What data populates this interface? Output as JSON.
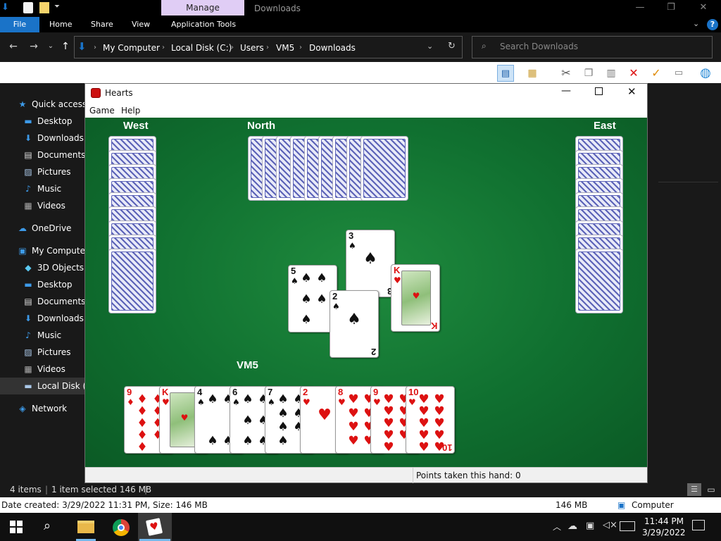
{
  "explorer": {
    "manage_tab": "Manage",
    "window_title": "Downloads",
    "ribbon_tabs": [
      "File",
      "Home",
      "Share",
      "View",
      "Application Tools"
    ],
    "breadcrumb": [
      "My Computer",
      "Local Disk (C:)",
      "Users",
      "VM5",
      "Downloads"
    ],
    "search_placeholder": "Search Downloads",
    "nav": [
      {
        "label": "Quick access",
        "icon": "star-icon",
        "indent": false
      },
      {
        "label": "Desktop",
        "icon": "desktop-icon",
        "indent": true
      },
      {
        "label": "Downloads",
        "icon": "download-icon",
        "indent": true
      },
      {
        "label": "Documents",
        "icon": "document-icon",
        "indent": true
      },
      {
        "label": "Pictures",
        "icon": "pictures-icon",
        "indent": true
      },
      {
        "label": "Music",
        "icon": "music-icon",
        "indent": true
      },
      {
        "label": "Videos",
        "icon": "videos-icon",
        "indent": true
      },
      {
        "label": "OneDrive",
        "icon": "cloud-icon",
        "indent": false
      },
      {
        "label": "My Computer",
        "icon": "computer-icon",
        "indent": false
      },
      {
        "label": "3D Objects",
        "icon": "cube-icon",
        "indent": true
      },
      {
        "label": "Desktop",
        "icon": "desktop-icon",
        "indent": true
      },
      {
        "label": "Documents",
        "icon": "document-icon",
        "indent": true
      },
      {
        "label": "Downloads",
        "icon": "download-icon",
        "indent": true
      },
      {
        "label": "Music",
        "icon": "music-icon",
        "indent": true
      },
      {
        "label": "Pictures",
        "icon": "pictures-icon",
        "indent": true
      },
      {
        "label": "Videos",
        "icon": "videos-icon",
        "indent": true
      },
      {
        "label": "Local Disk (C",
        "icon": "disk-icon",
        "indent": true
      },
      {
        "label": "Network",
        "icon": "network-icon",
        "indent": false
      }
    ],
    "status_items": "4 items",
    "status_selected": "1 item selected  146 MB",
    "details_text": "Date created: 3/29/2022 11:31 PM, Size: 146 MB",
    "details_size": "146 MB",
    "details_location": "Computer"
  },
  "hearts": {
    "title": "Hearts",
    "menu": [
      "Game",
      "Help"
    ],
    "players": {
      "west": "West",
      "north": "North",
      "east": "East",
      "south": "VM5"
    },
    "status": "Points taken this hand: 0",
    "trick": [
      {
        "rank": "3",
        "suit": "♠",
        "color": "black"
      },
      {
        "rank": "5",
        "suit": "♠",
        "color": "black"
      },
      {
        "rank": "K",
        "suit": "♥",
        "color": "red",
        "face": true
      },
      {
        "rank": "2",
        "suit": "♠",
        "color": "black"
      }
    ],
    "hand": [
      {
        "rank": "9",
        "suit": "♦",
        "color": "red"
      },
      {
        "rank": "K",
        "suit": "♥",
        "color": "red",
        "face": true
      },
      {
        "rank": "4",
        "suit": "♠",
        "color": "black"
      },
      {
        "rank": "6",
        "suit": "♠",
        "color": "black"
      },
      {
        "rank": "7",
        "suit": "♠",
        "color": "black"
      },
      {
        "rank": "2",
        "suit": "♥",
        "color": "red"
      },
      {
        "rank": "8",
        "suit": "♥",
        "color": "red"
      },
      {
        "rank": "9",
        "suit": "♥",
        "color": "red"
      },
      {
        "rank": "10",
        "suit": "♥",
        "color": "red"
      }
    ]
  },
  "taskbar": {
    "time": "11:44 PM",
    "date": "3/29/2022"
  }
}
